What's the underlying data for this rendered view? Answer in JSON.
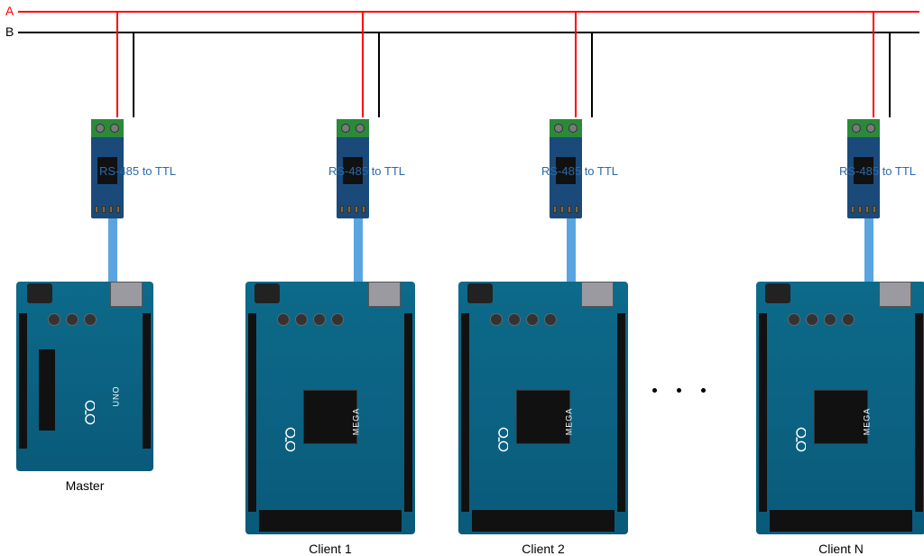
{
  "bus": {
    "line_a_label": "A",
    "line_b_label": "B"
  },
  "converter_label": "RS-485 to TTL",
  "nodes": [
    {
      "role": "master",
      "board": "Arduino Uno",
      "label": "Master"
    },
    {
      "role": "client",
      "board": "Arduino Mega",
      "label": "Client 1"
    },
    {
      "role": "client",
      "board": "Arduino Mega",
      "label": "Client 2"
    },
    {
      "role": "client",
      "board": "Arduino Mega",
      "label": "Client N"
    }
  ],
  "ellipsis": ". . .",
  "board_text": {
    "uno": "UNO",
    "mega": "MEGA"
  },
  "chart_data": {
    "type": "network-bus",
    "bus_lines": [
      "A",
      "B"
    ],
    "protocol": "RS-485",
    "converter": "RS-485 to TTL",
    "topology": "multi-drop",
    "nodes": [
      {
        "role": "Master",
        "board": "Arduino Uno",
        "count": 1
      },
      {
        "role": "Client",
        "board": "Arduino Mega",
        "count": "N"
      }
    ]
  }
}
